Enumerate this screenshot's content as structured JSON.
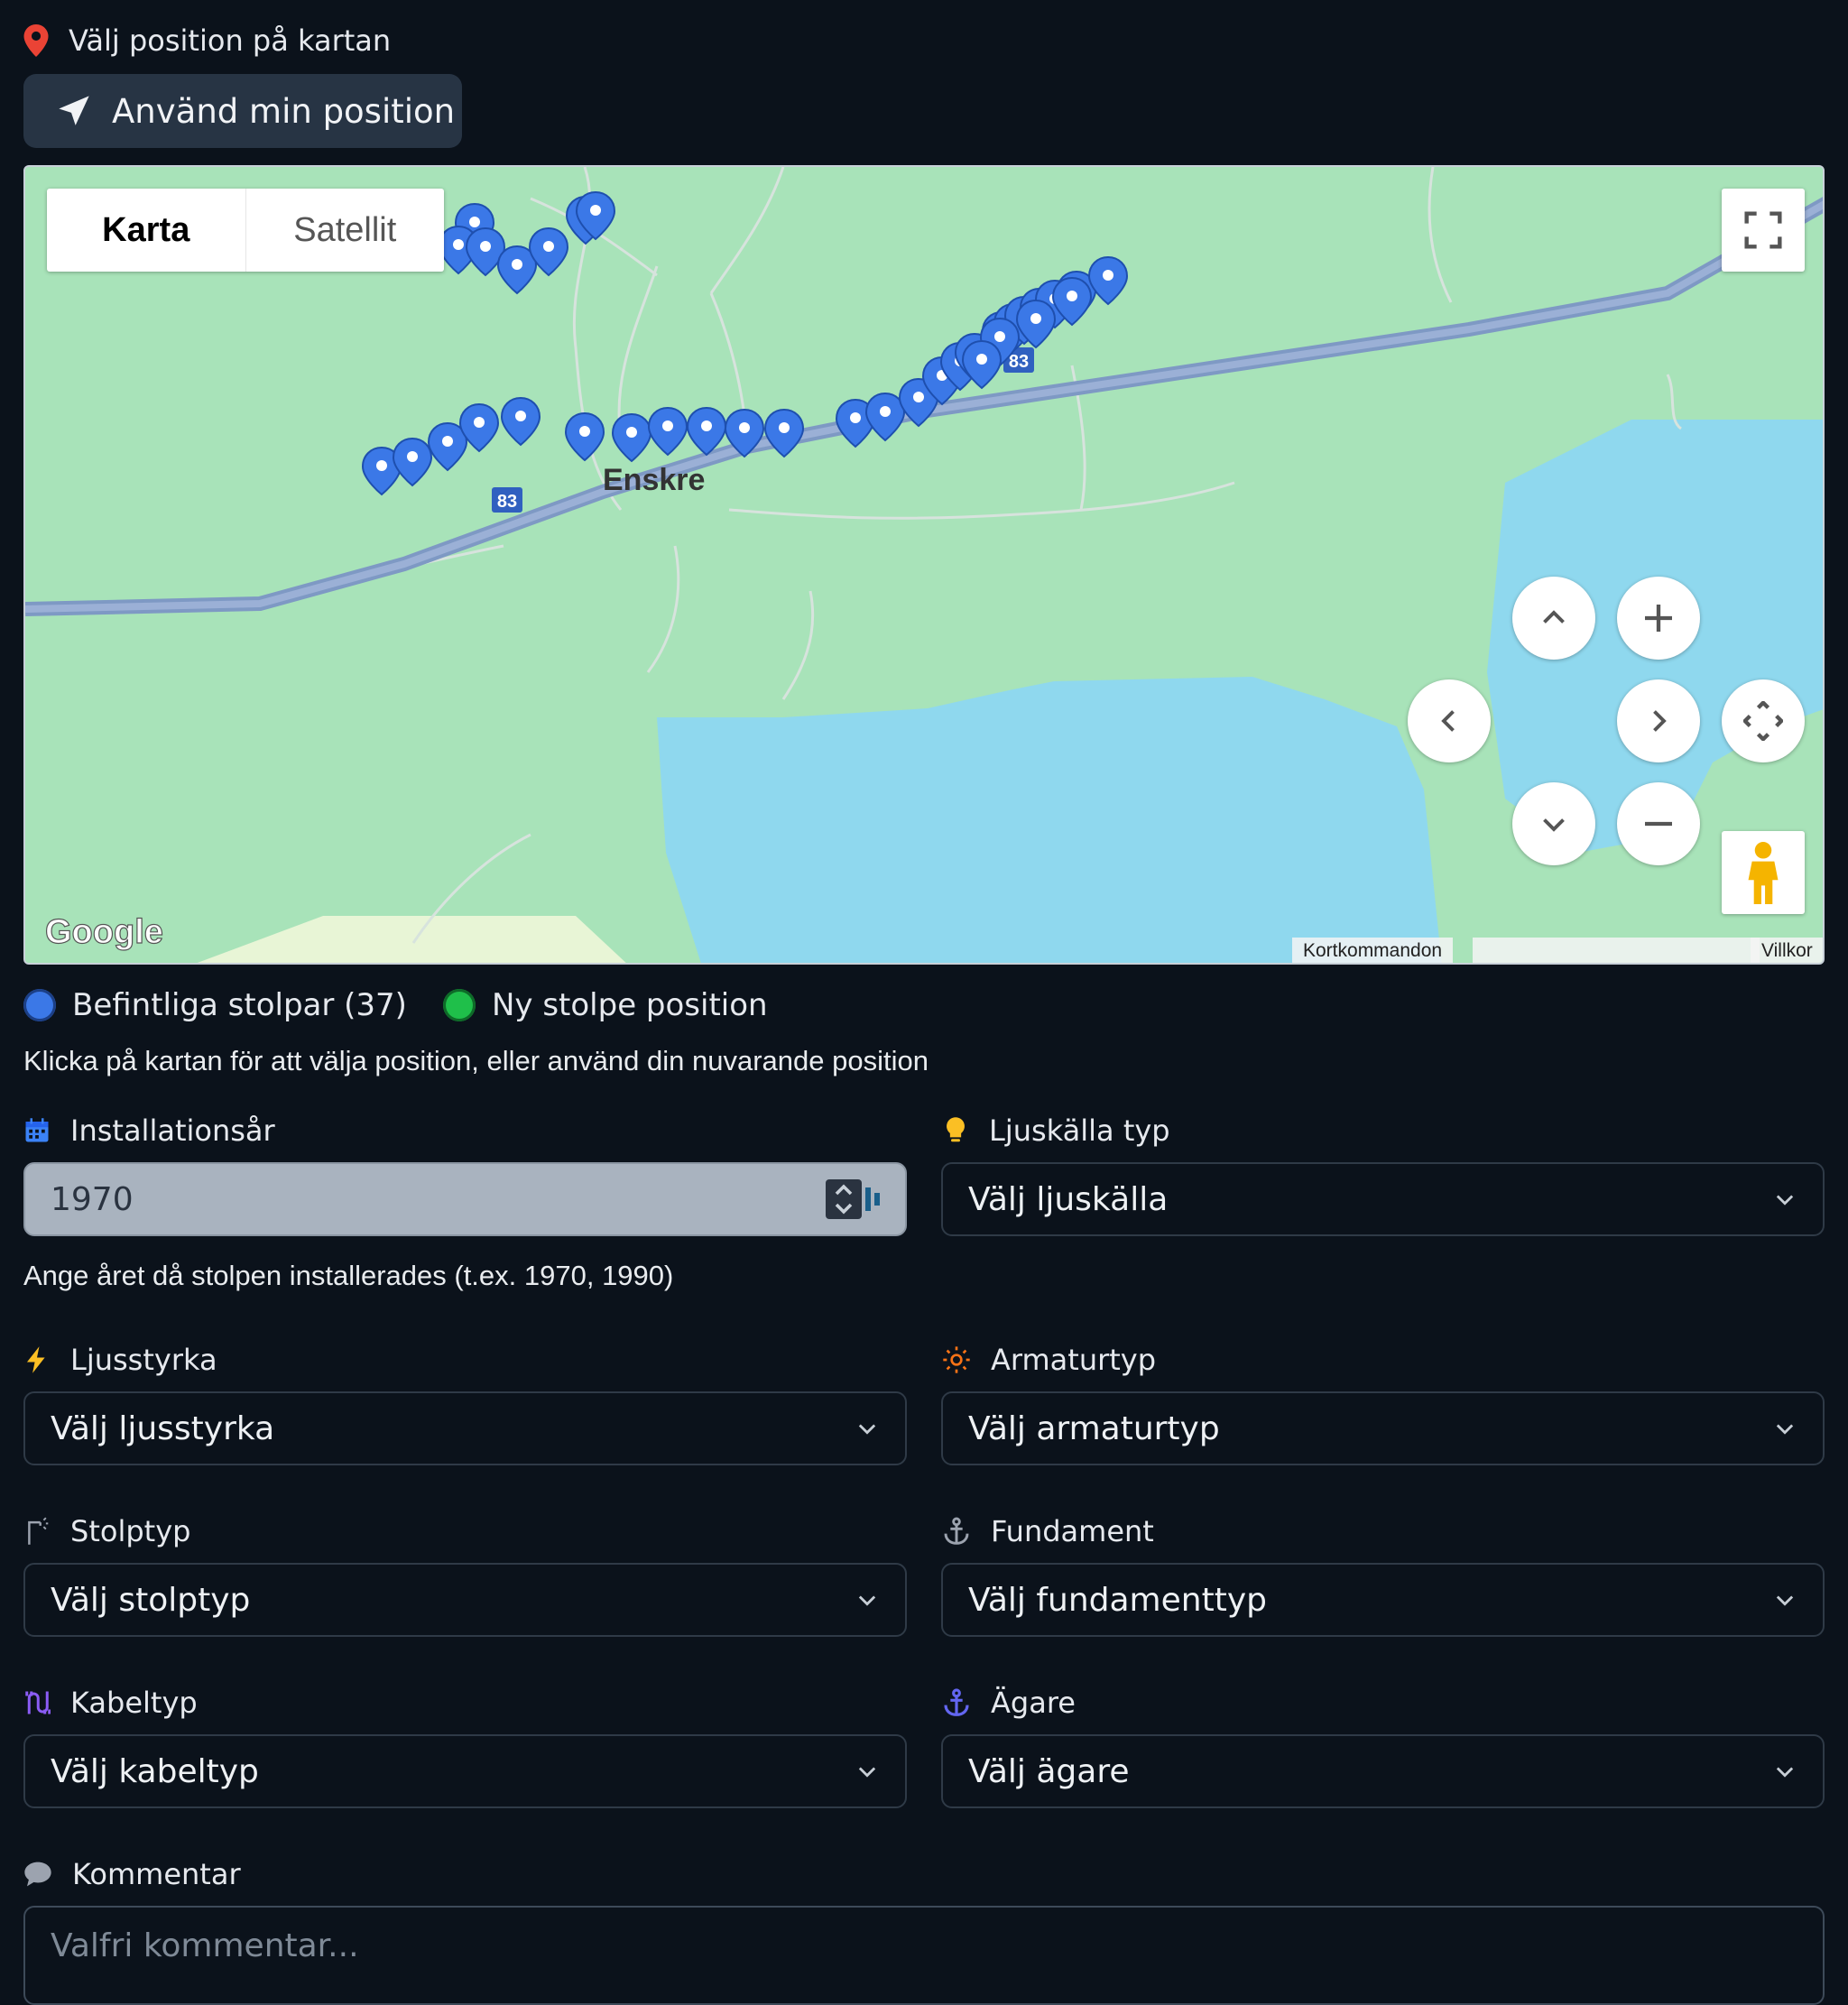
{
  "position_section": {
    "label": "Välj position på kartan",
    "use_position_button": "Använd min position"
  },
  "map": {
    "type_buttons": [
      "Karta",
      "Satellit"
    ],
    "active_type": "Karta",
    "road_number": "83",
    "place_label": "Enskre",
    "keyboard_shortcuts": "Kortkommandon",
    "terms": "Villkor",
    "logo": "Google",
    "marker_color": "#3b78e7",
    "marker_count_visible": 37
  },
  "legend": {
    "existing": "Befintliga stolpar (37)",
    "new": "Ny stolpe position",
    "existing_color": "#3b78e7",
    "new_color": "#1fbf4a"
  },
  "map_help": "Klicka på kartan för att välja position, eller använd din nuvarande position",
  "fields": {
    "installation_year": {
      "label": "Installationsår",
      "value": "1970",
      "help": "Ange året då stolpen installerades (t.ex. 1970, 1990)"
    },
    "light_source": {
      "label": "Ljuskälla typ",
      "value": "Välj ljuskälla"
    },
    "light_intensity": {
      "label": "Ljusstyrka",
      "value": "Välj ljusstyrka"
    },
    "fixture_type": {
      "label": "Armaturtyp",
      "value": "Välj armaturtyp"
    },
    "pole_type": {
      "label": "Stolptyp",
      "value": "Välj stolptyp"
    },
    "foundation": {
      "label": "Fundament",
      "value": "Välj fundamenttyp"
    },
    "cable_type": {
      "label": "Kabeltyp",
      "value": "Välj kabeltyp"
    },
    "owner": {
      "label": "Ägare",
      "value": "Välj ägare"
    },
    "comment": {
      "label": "Kommentar",
      "placeholder": "Valfri kommentar..."
    }
  },
  "icons": {
    "position": "map-pin-icon",
    "locate": "navigation-arrow-icon",
    "year": "calendar-icon",
    "light_source": "lightbulb-icon",
    "intensity": "lightning-icon",
    "fixture": "sun-icon",
    "pole": "street-lamp-icon",
    "foundation": "anchor-icon",
    "cable": "cable-icon",
    "owner": "anchor-icon",
    "comment": "speech-bubble-icon"
  }
}
